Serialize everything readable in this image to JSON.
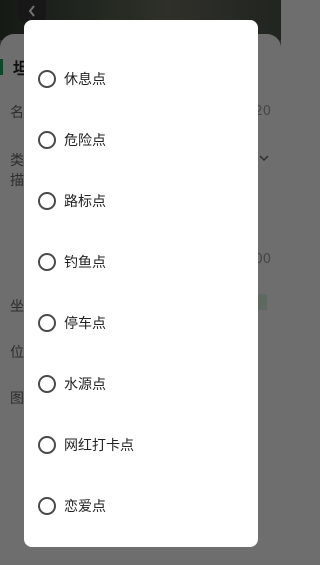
{
  "background_form": {
    "title_char": "坦",
    "labels": [
      "名",
      "类",
      "描",
      "坐",
      "位",
      "图"
    ],
    "right_values": [
      "20",
      "00"
    ]
  },
  "dialog": {
    "options": [
      {
        "label": "休息点",
        "selected": false
      },
      {
        "label": "危险点",
        "selected": false
      },
      {
        "label": "路标点",
        "selected": false
      },
      {
        "label": "钓鱼点",
        "selected": false
      },
      {
        "label": "停车点",
        "selected": false
      },
      {
        "label": "水源点",
        "selected": false
      },
      {
        "label": "网红打卡点",
        "selected": false
      },
      {
        "label": "恋爱点",
        "selected": false
      }
    ]
  },
  "icons": {
    "back": "chevron-left-icon",
    "dropdown": "chevron-down-icon",
    "radio": "radio-unchecked-icon"
  },
  "colors": {
    "accent": "#22a05a",
    "dialog_bg": "#ffffff",
    "overlay": "rgba(0,0,0,0.55)"
  }
}
